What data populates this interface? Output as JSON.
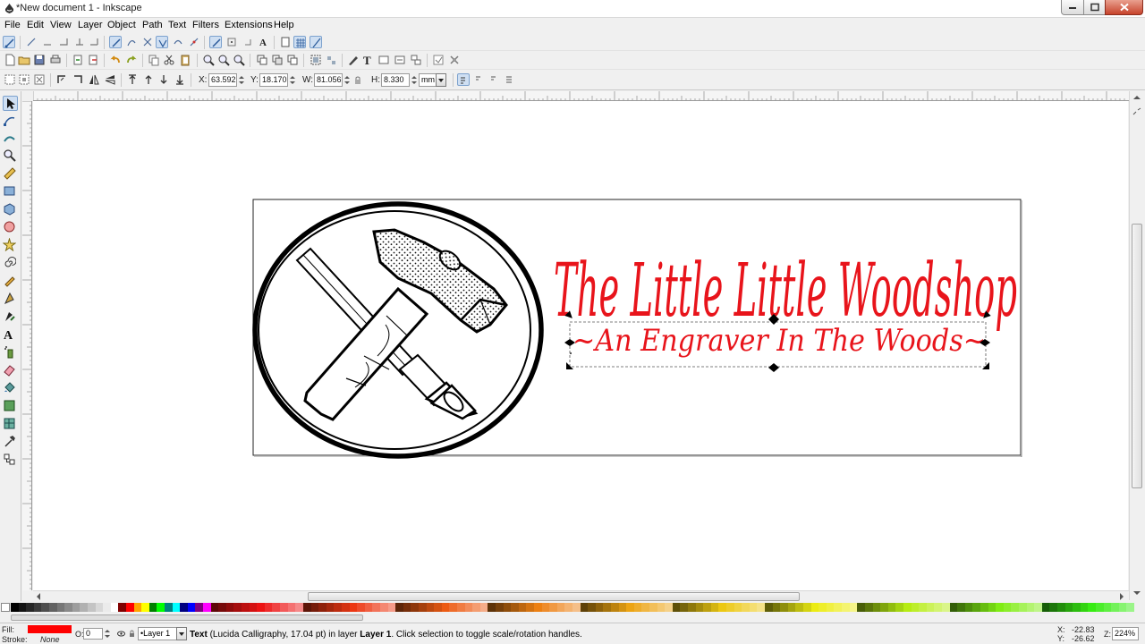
{
  "window": {
    "title": "*New document 1 - Inkscape"
  },
  "menu": [
    "File",
    "Edit",
    "View",
    "Layer",
    "Object",
    "Path",
    "Text",
    "Filters",
    "Extensions",
    "Help"
  ],
  "controls": {
    "x_label": "X:",
    "x_value": "63.592",
    "y_label": "Y:",
    "y_value": "18.170",
    "w_label": "W:",
    "w_value": "81.056",
    "h_label": "H:",
    "h_value": "8.330",
    "unit": "mm"
  },
  "canvas": {
    "title_text": "The Little Little Woodshop",
    "subtitle_text": "~An Engraver In The Woods~",
    "title_color": "#e8141b"
  },
  "status": {
    "fill_label": "Fill:",
    "stroke_label": "Stroke:",
    "stroke_value": "None",
    "fill_color": "#ff0000",
    "opacity_label": "O:",
    "opacity_value": "0",
    "layer": "•Layer 1",
    "msg_type": "Text",
    "msg_mid": " (Lucida Calligraphy, 17.04 pt) in layer ",
    "msg_layer": "Layer 1",
    "msg_end": ". Click selection to toggle scale/rotation handles.",
    "x_label": "X:",
    "x_value": "-22.83",
    "y_label": "Y:",
    "y_value": "-26.62",
    "zoom_label": "Z:",
    "zoom_value": "224%"
  }
}
